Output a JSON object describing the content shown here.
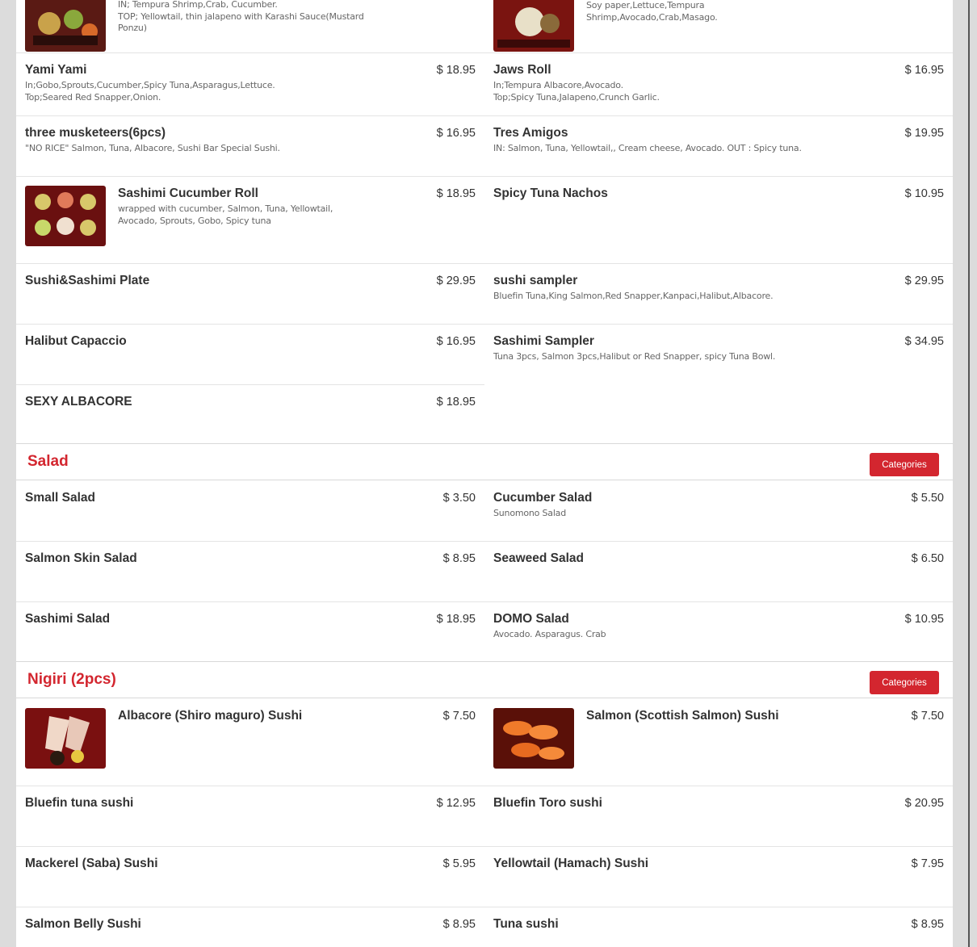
{
  "top_partial": {
    "left": {
      "desc": "IN; Tempura Shrimp,Crab, Cucumber.\nTOP; Yellowtail, thin jalapeno with Karashi Sauce(Mustard Ponzu)"
    },
    "right": {
      "desc": "Soy paper,Lettuce,Tempura Shrimp,Avocado,Crab,Masago."
    }
  },
  "rolls": [
    {
      "name": "Yami Yami",
      "price": "$ 18.95",
      "desc": "In;Gobo,Sprouts,Cucumber,Spicy Tuna,Asparagus,Lettuce.\nTop;Seared Red Snapper,Onion."
    },
    {
      "name": "Jaws Roll",
      "price": "$ 16.95",
      "desc": "In;Tempura Albacore,Avocado.\nTop;Spicy Tuna,Jalapeno,Crunch Garlic."
    },
    {
      "name": "three musketeers(6pcs)",
      "price": "$ 16.95",
      "desc": "\"NO RICE\" Salmon, Tuna, Albacore, Sushi Bar Special Sushi."
    },
    {
      "name": "Tres Amigos",
      "price": "$ 19.95",
      "desc": "IN: Salmon, Tuna, Yellowtail,, Cream cheese, Avocado. OUT : Spicy tuna."
    },
    {
      "name": "Sashimi Cucumber Roll",
      "price": "$ 18.95",
      "desc": "wrapped with cucumber, Salmon, Tuna, Yellowtail, Avocado, Sprouts, Gobo, Spicy tuna"
    },
    {
      "name": "Spicy Tuna Nachos",
      "price": "$ 10.95",
      "desc": ""
    },
    {
      "name": "Sushi&Sashimi Plate",
      "price": "$ 29.95",
      "desc": ""
    },
    {
      "name": "sushi sampler",
      "price": "$ 29.95",
      "desc": "Bluefin Tuna,King Salmon,Red Snapper,Kanpaci,Halibut,Albacore."
    },
    {
      "name": "Halibut Capaccio",
      "price": "$ 16.95",
      "desc": ""
    },
    {
      "name": "Sashimi Sampler",
      "price": "$ 34.95",
      "desc": "Tuna 3pcs, Salmon 3pcs,Halibut or Red Snapper, spicy Tuna Bowl."
    },
    {
      "name": "SEXY ALBACORE",
      "price": "$ 18.95",
      "desc": ""
    }
  ],
  "salad": {
    "title": "Salad",
    "button": "Categories",
    "items": [
      {
        "name": "Small Salad",
        "price": "$ 3.50",
        "desc": ""
      },
      {
        "name": "Cucumber Salad",
        "price": "$ 5.50",
        "desc": "Sunomono Salad"
      },
      {
        "name": "Salmon Skin Salad",
        "price": "$ 8.95",
        "desc": ""
      },
      {
        "name": "Seaweed Salad",
        "price": "$ 6.50",
        "desc": ""
      },
      {
        "name": "Sashimi Salad",
        "price": "$ 18.95",
        "desc": ""
      },
      {
        "name": "DOMO Salad",
        "price": "$ 10.95",
        "desc": "Avocado. Asparagus. Crab"
      }
    ]
  },
  "nigiri": {
    "title": "Nigiri (2pcs)",
    "button": "Categories",
    "items": [
      {
        "name": "Albacore (Shiro maguro) Sushi",
        "price": "$ 7.50",
        "desc": ""
      },
      {
        "name": "Salmon (Scottish Salmon) Sushi",
        "price": "$ 7.50",
        "desc": ""
      },
      {
        "name": "Bluefin tuna sushi",
        "price": "$ 12.95",
        "desc": ""
      },
      {
        "name": "Bluefin Toro sushi",
        "price": "$ 20.95",
        "desc": ""
      },
      {
        "name": "Mackerel (Saba) Sushi",
        "price": "$ 5.95",
        "desc": ""
      },
      {
        "name": "Yellowtail (Hamach) Sushi",
        "price": "$ 7.95",
        "desc": ""
      },
      {
        "name": "Salmon Belly Sushi",
        "price": "$ 8.95",
        "desc": ""
      },
      {
        "name": "Tuna sushi",
        "price": "$ 8.95",
        "desc": ""
      }
    ]
  },
  "colors": {
    "accent": "#d3262f",
    "background": "#dcdcdc"
  }
}
